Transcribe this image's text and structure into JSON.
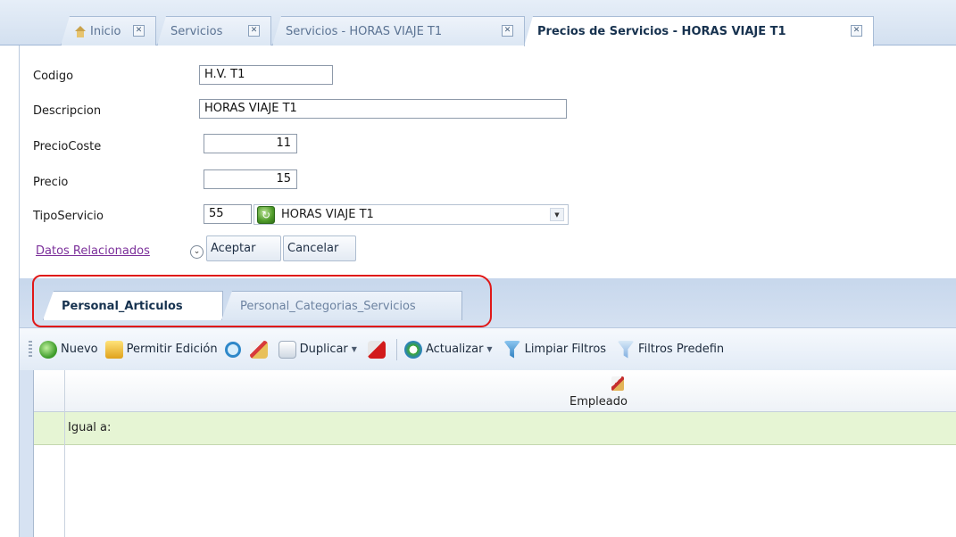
{
  "doc_tabs": [
    {
      "label": "Inicio",
      "active": false
    },
    {
      "label": "Servicios",
      "active": false
    },
    {
      "label": "Servicios - HORAS VIAJE T1",
      "active": false
    },
    {
      "label": "Precios de Servicios - HORAS VIAJE T1",
      "active": true
    }
  ],
  "form": {
    "codigo_label": "Codigo",
    "codigo_value": "H.V. T1",
    "descripcion_label": "Descripcion",
    "descripcion_value": "HORAS VIAJE T1",
    "precio_coste_label": "PrecioCoste",
    "precio_coste_value": "11",
    "precio_label": "Precio",
    "precio_value": "15",
    "tipo_servicio_label": "TipoServicio",
    "tipo_servicio_code": "55",
    "tipo_servicio_name": "HORAS VIAJE T1"
  },
  "actions": {
    "related_link": "Datos Relacionados",
    "accept": "Aceptar",
    "cancel": "Cancelar"
  },
  "detail_tabs": [
    {
      "label": "Personal_Articulos",
      "active": true
    },
    {
      "label": "Personal_Categorias_Servicios",
      "active": false
    }
  ],
  "toolbar": {
    "new": "Nuevo",
    "allow_edit": "Permitir Edición",
    "duplicate": "Duplicar",
    "refresh": "Actualizar",
    "clear_filters": "Limpiar Filtros",
    "predefined_filters": "Filtros Predefin"
  },
  "grid": {
    "column": "Empleado",
    "filter_operator": "Igual a:"
  },
  "colors": {
    "annotation_outline": "#e01818",
    "filter_row": "#e6f5d4",
    "link": "#7b2f9a"
  }
}
